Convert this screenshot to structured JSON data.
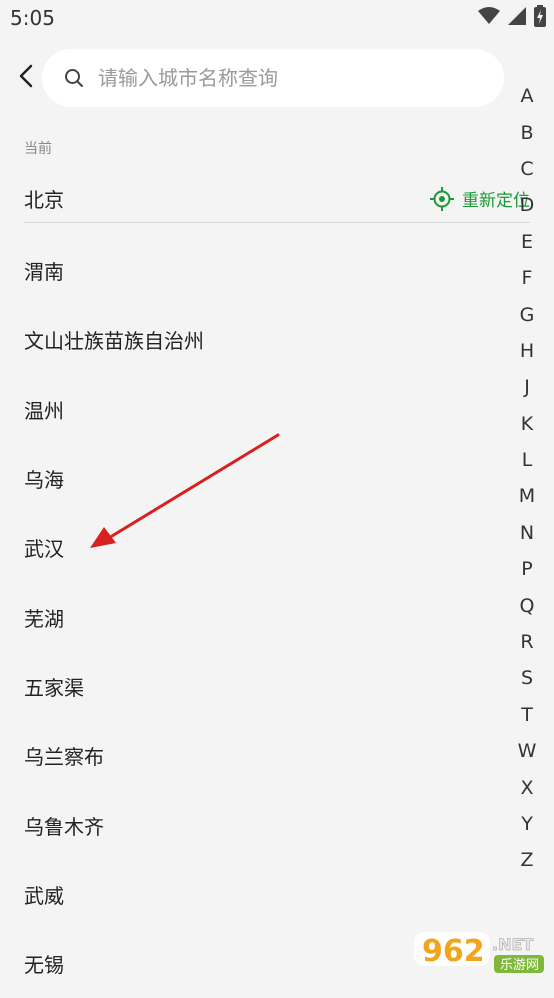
{
  "status_bar": {
    "time": "5:05"
  },
  "search": {
    "placeholder": "请输入城市名称查询",
    "value": ""
  },
  "current": {
    "label": "当前",
    "city": "北京",
    "relocate_label": "重新定位"
  },
  "cities": [
    "渭南",
    "文山壮族苗族自治州",
    "温州",
    "乌海",
    "武汉",
    "芜湖",
    "五家渠",
    "乌兰察布",
    "乌鲁木齐",
    "武威",
    "无锡"
  ],
  "alphabet": [
    "A",
    "B",
    "C",
    "D",
    "E",
    "F",
    "G",
    "H",
    "J",
    "K",
    "L",
    "M",
    "N",
    "P",
    "Q",
    "R",
    "S",
    "T",
    "W",
    "X",
    "Y",
    "Z"
  ],
  "colors": {
    "accent": "#1a9a36",
    "annotation": "#d92020",
    "background": "#f4f4f4"
  },
  "icons": {
    "back": "back-arrow-icon",
    "search": "search-icon",
    "relocate": "locate-crosshair-icon"
  },
  "watermark": {
    "brand_number": "962",
    "brand_suffix": ".NET",
    "brand_tagline": "乐游网"
  }
}
